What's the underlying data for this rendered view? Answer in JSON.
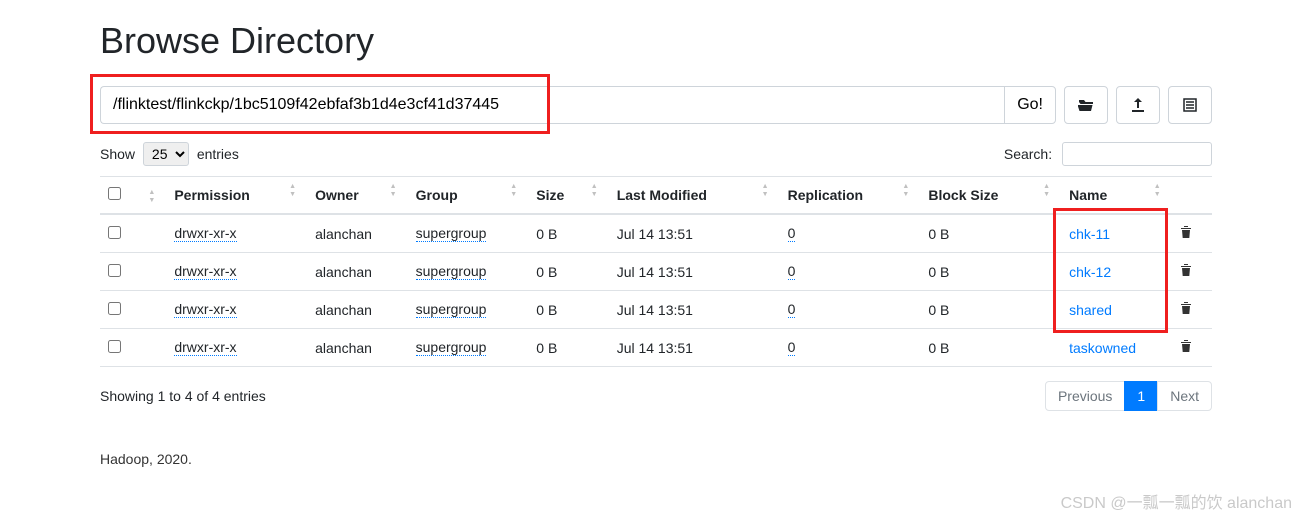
{
  "title": "Browse Directory",
  "path": "/flinktest/flinkckp/1bc5109f42ebfaf3b1d4e3cf41d37445",
  "go_label": "Go!",
  "entries": {
    "show": "Show",
    "selected": "25",
    "suffix": "entries"
  },
  "search": {
    "label": "Search:",
    "value": ""
  },
  "columns": {
    "permission": "Permission",
    "owner": "Owner",
    "group": "Group",
    "size": "Size",
    "lastmod": "Last Modified",
    "replication": "Replication",
    "blocksize": "Block Size",
    "name": "Name"
  },
  "rows": [
    {
      "permission": "drwxr-xr-x",
      "owner": "alanchan",
      "group": "supergroup",
      "size": "0 B",
      "lastmod": "Jul 14 13:51",
      "replication": "0",
      "blocksize": "0 B",
      "name": "chk-11"
    },
    {
      "permission": "drwxr-xr-x",
      "owner": "alanchan",
      "group": "supergroup",
      "size": "0 B",
      "lastmod": "Jul 14 13:51",
      "replication": "0",
      "blocksize": "0 B",
      "name": "chk-12"
    },
    {
      "permission": "drwxr-xr-x",
      "owner": "alanchan",
      "group": "supergroup",
      "size": "0 B",
      "lastmod": "Jul 14 13:51",
      "replication": "0",
      "blocksize": "0 B",
      "name": "shared"
    },
    {
      "permission": "drwxr-xr-x",
      "owner": "alanchan",
      "group": "supergroup",
      "size": "0 B",
      "lastmod": "Jul 14 13:51",
      "replication": "0",
      "blocksize": "0 B",
      "name": "taskowned"
    }
  ],
  "info_text": "Showing 1 to 4 of 4 entries",
  "pagination": {
    "previous": "Previous",
    "page1": "1",
    "next": "Next"
  },
  "footer": "Hadoop, 2020.",
  "watermark": "CSDN @一瓢一瓢的饮 alanchan"
}
